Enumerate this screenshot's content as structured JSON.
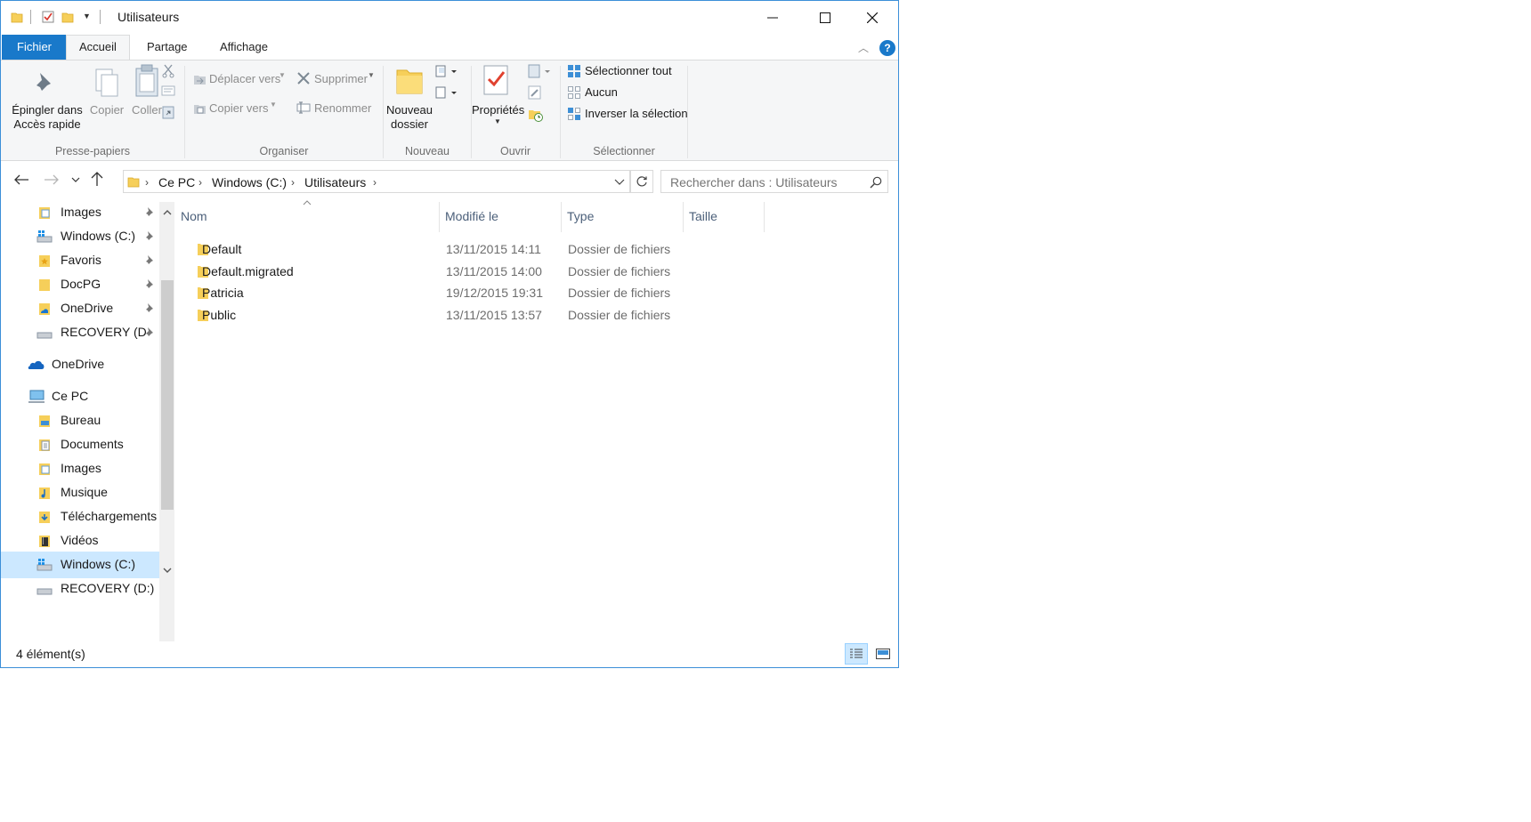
{
  "window": {
    "title": "Utilisateurs",
    "accent": "#1979ca"
  },
  "tabs": [
    {
      "label": "Fichier"
    },
    {
      "label": "Accueil"
    },
    {
      "label": "Partage"
    },
    {
      "label": "Affichage"
    }
  ],
  "ribbon": {
    "clipboard": {
      "pin_label_1": "Épingler dans",
      "pin_label_2": "Accès rapide",
      "copy_label": "Copier",
      "paste_label": "Coller",
      "group_label": "Presse-papiers"
    },
    "organize": {
      "move_label": "Déplacer vers",
      "copy_to_label": "Copier vers",
      "delete_label": "Supprimer",
      "rename_label": "Renommer",
      "group_label": "Organiser"
    },
    "new": {
      "new_folder_1": "Nouveau",
      "new_folder_2": "dossier",
      "group_label": "Nouveau"
    },
    "open": {
      "properties_label": "Propriétés",
      "group_label": "Ouvrir"
    },
    "select": {
      "select_all": "Sélectionner tout",
      "select_none": "Aucun",
      "invert": "Inverser la sélection",
      "group_label": "Sélectionner"
    }
  },
  "address": {
    "crumbs": [
      "Ce PC",
      "Windows (C:)",
      "Utilisateurs"
    ],
    "search_placeholder": "Rechercher dans : Utilisateurs"
  },
  "nav": {
    "quick_access": [
      {
        "label": "Images"
      },
      {
        "label": "Windows (C:)"
      },
      {
        "label": "Favoris"
      },
      {
        "label": "DocPG"
      },
      {
        "label": "OneDrive"
      },
      {
        "label": "RECOVERY (D"
      }
    ],
    "onedrive": "OneDrive",
    "this_pc": "Ce PC",
    "pc_items": [
      {
        "label": "Bureau"
      },
      {
        "label": "Documents"
      },
      {
        "label": "Images"
      },
      {
        "label": "Musique"
      },
      {
        "label": "Téléchargements"
      },
      {
        "label": "Vidéos"
      },
      {
        "label": "Windows (C:)"
      },
      {
        "label": "RECOVERY (D:)"
      }
    ]
  },
  "list": {
    "columns": [
      "Nom",
      "Modifié le",
      "Type",
      "Taille"
    ],
    "rows": [
      {
        "name": "Default",
        "date": "13/11/2015 14:11",
        "type": "Dossier de fichiers"
      },
      {
        "name": "Default.migrated",
        "date": "13/11/2015 14:00",
        "type": "Dossier de fichiers"
      },
      {
        "name": "Patricia",
        "date": "19/12/2015 19:31",
        "type": "Dossier de fichiers"
      },
      {
        "name": "Public",
        "date": "13/11/2015 13:57",
        "type": "Dossier de fichiers"
      }
    ]
  },
  "status": {
    "count": "4 élément(s)"
  }
}
